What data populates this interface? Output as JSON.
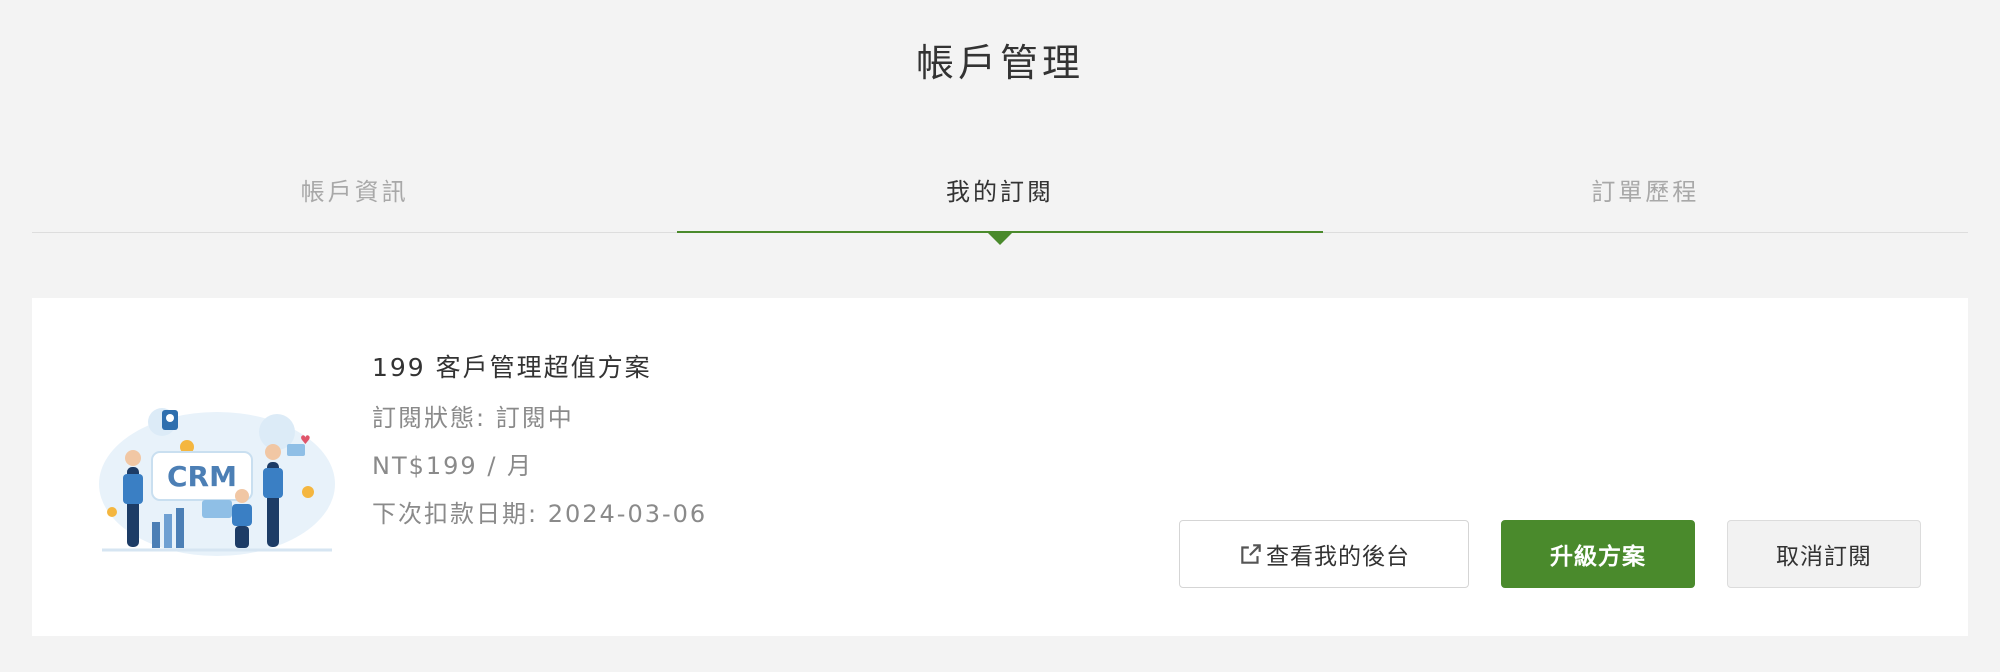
{
  "page": {
    "title": "帳戶管理"
  },
  "tabs": [
    {
      "label": "帳戶資訊",
      "active": false
    },
    {
      "label": "我的訂閱",
      "active": true
    },
    {
      "label": "訂單歷程",
      "active": false
    }
  ],
  "subscription": {
    "illustration_text": "CRM",
    "plan_name": "199 客戶管理超值方案",
    "status": "訂閱狀態: 訂閱中",
    "price": "NT$199 / 月",
    "next_billing": "下次扣款日期: 2024-03-06"
  },
  "actions": {
    "dashboard_label": "查看我的後台",
    "dashboard_icon": "external-link-icon",
    "upgrade_label": "升級方案",
    "cancel_label": "取消訂閱"
  },
  "colors": {
    "accent": "#4a8a2c",
    "background": "#f3f3f3",
    "card": "#ffffff",
    "muted_text": "#8a8a8a",
    "inactive_tab": "#a8a8a8"
  }
}
